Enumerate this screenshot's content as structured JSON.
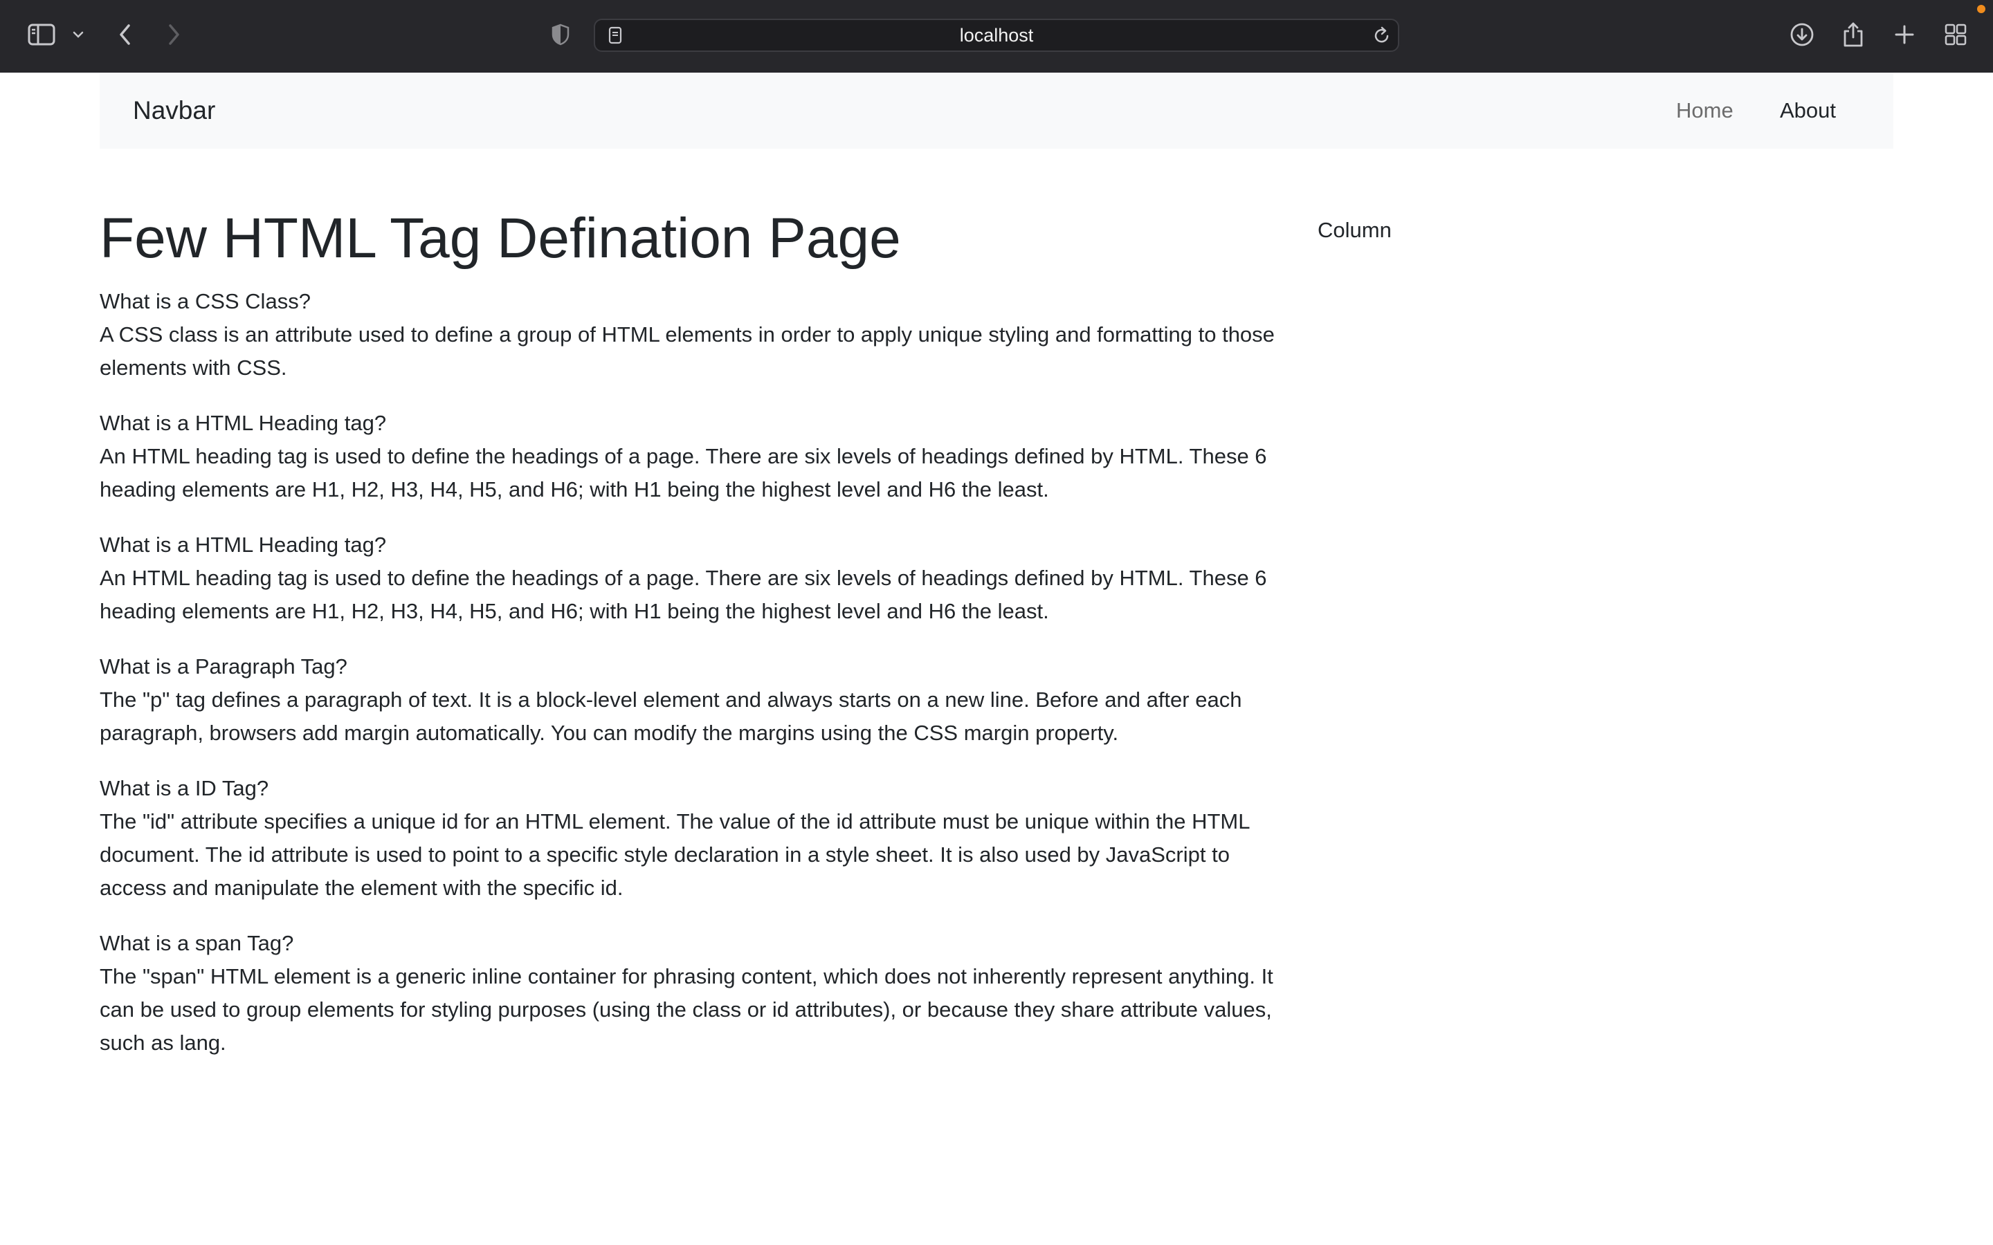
{
  "browser": {
    "url": "localhost"
  },
  "navbar": {
    "brand": "Navbar",
    "links": [
      {
        "label": "Home"
      },
      {
        "label": "About"
      }
    ]
  },
  "main": {
    "title": "Few HTML Tag Defination Page",
    "sections": [
      {
        "question": "What is a CSS Class?",
        "answer": "A CSS class is an attribute used to define a group of HTML elements in order to apply unique styling and formatting to those elements with CSS."
      },
      {
        "question": "What is a HTML Heading tag?",
        "answer": "An HTML heading tag is used to define the headings of a page. There are six levels of headings defined by HTML. These 6 heading elements are H1, H2, H3, H4, H5, and H6; with H1 being the highest level and H6 the least."
      },
      {
        "question": "What is a HTML Heading tag?",
        "answer": "An HTML heading tag is used to define the headings of a page. There are six levels of headings defined by HTML. These 6 heading elements are H1, H2, H3, H4, H5, and H6; with H1 being the highest level and H6 the least."
      },
      {
        "question": "What is a Paragraph Tag?",
        "answer": "The \"p\" tag defines a paragraph of text. It is a block-level element and always starts on a new line. Before and after each paragraph, browsers add margin automatically. You can modify the margins using the CSS margin property."
      },
      {
        "question": "What is a ID Tag?",
        "answer": "The \"id\" attribute specifies a unique id for an HTML element. The value of the id attribute must be unique within the HTML document. The id attribute is used to point to a specific style declaration in a style sheet. It is also used by JavaScript to access and manipulate the element with the specific id."
      },
      {
        "question": "What is a span Tag?",
        "answer": "The \"span\" HTML element is a generic inline container for phrasing content, which does not inherently represent anything. It can be used to group elements for styling purposes (using the class or id attributes), or because they share attribute values, such as lang."
      }
    ]
  },
  "side": {
    "column_label": "Column"
  },
  "icons": {
    "sidebar": "sidebar-icon",
    "chevron": "chevron-down-icon",
    "back": "back-arrow-icon",
    "forward": "forward-arrow-icon",
    "privacy": "privacy-shield-icon",
    "page": "page-icon",
    "reload": "reload-icon",
    "download": "download-icon",
    "share": "share-icon",
    "new_tab": "plus-icon",
    "tab_overview": "tab-overview-icon"
  },
  "colors": {
    "chrome_bg": "#27272b",
    "navbar_bg": "#f8f9fa",
    "text": "#212529",
    "nav_muted": "#6c6c6c",
    "notification": "#f08c1d"
  }
}
